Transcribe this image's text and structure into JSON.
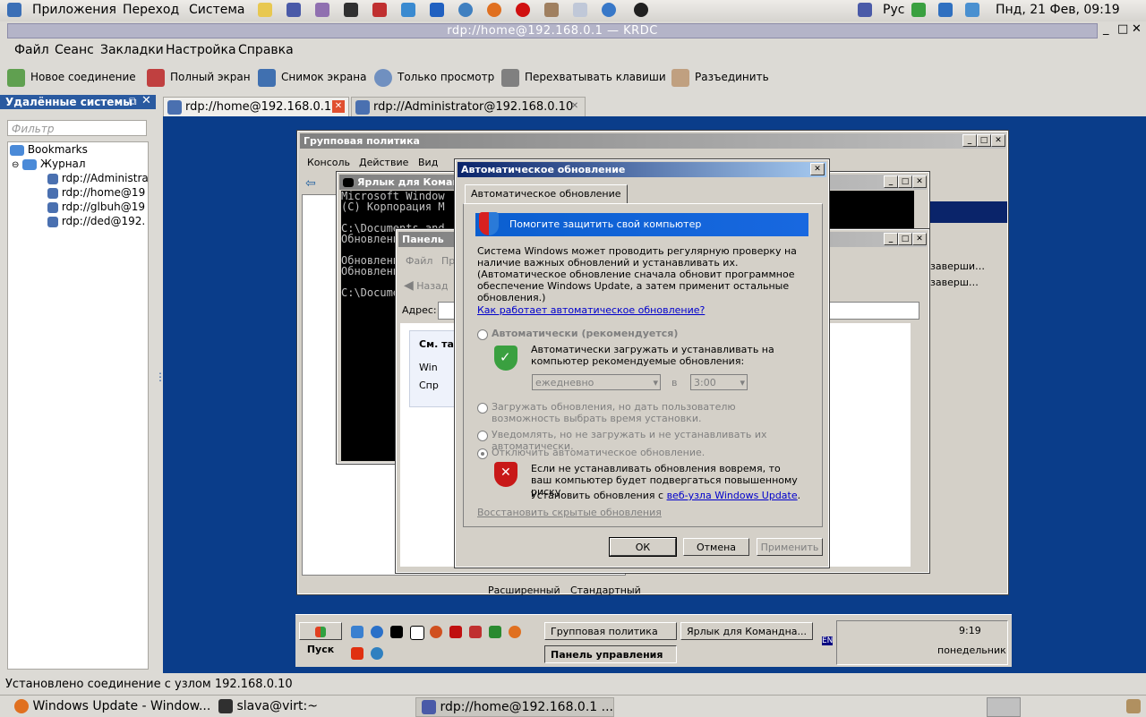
{
  "gnome_panel": {
    "menus": [
      "Приложения",
      "Переход",
      "Система"
    ],
    "keyboard_layout": "Рус",
    "datetime": "Пнд, 21 Фев, 09:19"
  },
  "window": {
    "title": "rdp://home@192.168.0.1 — KRDC"
  },
  "menubar": [
    "Файл",
    "Сеанс",
    "Закладки",
    "Настройка",
    "Справка"
  ],
  "toolbar": {
    "new_connection": "Новое соединение",
    "fullscreen": "Полный экран",
    "screenshot": "Снимок экрана",
    "view_only": "Только просмотр",
    "grab_keys": "Перехватывать клавиши",
    "disconnect": "Разъединить"
  },
  "sidebar": {
    "title": "Удалённые системы",
    "filter_placeholder": "Фильтр",
    "bookmarks": "Bookmarks",
    "history": "Журнал",
    "items": [
      "rdp://Administra",
      "rdp://home@19",
      "rdp://glbuh@19",
      "rdp://ded@192."
    ]
  },
  "tabs": [
    {
      "label": "rdp://home@192.168.0.1"
    },
    {
      "label": "rdp://Administrator@192.168.0.10"
    }
  ],
  "remote": {
    "gp_window": {
      "title": "Групповая политика",
      "menu": [
        "Консоль",
        "Действие",
        "Вид"
      ],
      "tabs": [
        "Расширенный",
        "Стандартный"
      ],
      "right_items": [
        "заверши…",
        "заверш…"
      ]
    },
    "cmd_window": {
      "title": "Ярлык для Команд",
      "lines": [
        "Microsoft Window",
        "(C) Корпорация М",
        "",
        "C:\\Documents and",
        "Обновления отклю",
        "",
        "Обновления отклю",
        "Обновления отклю",
        "",
        "C:\\Documents and"
      ]
    },
    "cp_window": {
      "title": "Панель",
      "menu": [
        "Файл",
        "Пр"
      ],
      "back": "Назад",
      "address_label": "Адрес:",
      "see_also": "См. так",
      "links": [
        "Win",
        "Спр"
      ]
    },
    "au_dialog": {
      "title": "Автоматическое обновление",
      "tab": "Автоматическое обновление",
      "banner": "Помогите защитить свой компьютер",
      "description": "Система Windows может проводить регулярную проверку на наличие важных обновлений и устанавливать их. (Автоматическое обновление сначала обновит программное обеспечение Windows Update, а затем применит остальные обновления.)",
      "how_link": "Как работает автоматическое обновление?",
      "opt_auto": "Автоматически (рекомендуется)",
      "opt_auto_desc": "Автоматически загружать и устанавливать на компьютер рекомендуемые обновления:",
      "schedule_day": "ежедневно",
      "schedule_at": "в",
      "schedule_time": "3:00",
      "opt_download": "Загружать обновления, но дать пользователю возможность выбрать время установки.",
      "opt_notify": "Уведомлять, но не загружать и не устанавливать их автоматически.",
      "opt_off": "Отключить автоматическое обновление.",
      "warning": "Если не устанавливать обновления вовремя, то ваш компьютер будет подвергаться повышенному риску.",
      "install_from": "Установить обновления с",
      "site_link": "веб-узла Windows Update",
      "restore_link": "Восстановить скрытые обновления",
      "ok": "ОК",
      "cancel": "Отмена",
      "apply": "Применить"
    },
    "win_taskbar": {
      "start": "Пуск",
      "tasks": [
        "Групповая политика",
        "Ярлык для Командна...",
        "Панель управления"
      ],
      "lang": "EN",
      "time": "9:19",
      "day": "понедельник"
    }
  },
  "statusbar": "Установлено соединение с узлом 192.168.0.10",
  "taskbar": {
    "tasks": [
      "Windows Update - Window...",
      "slava@virt:~",
      "rdp://home@192.168.0.1 ..."
    ]
  }
}
